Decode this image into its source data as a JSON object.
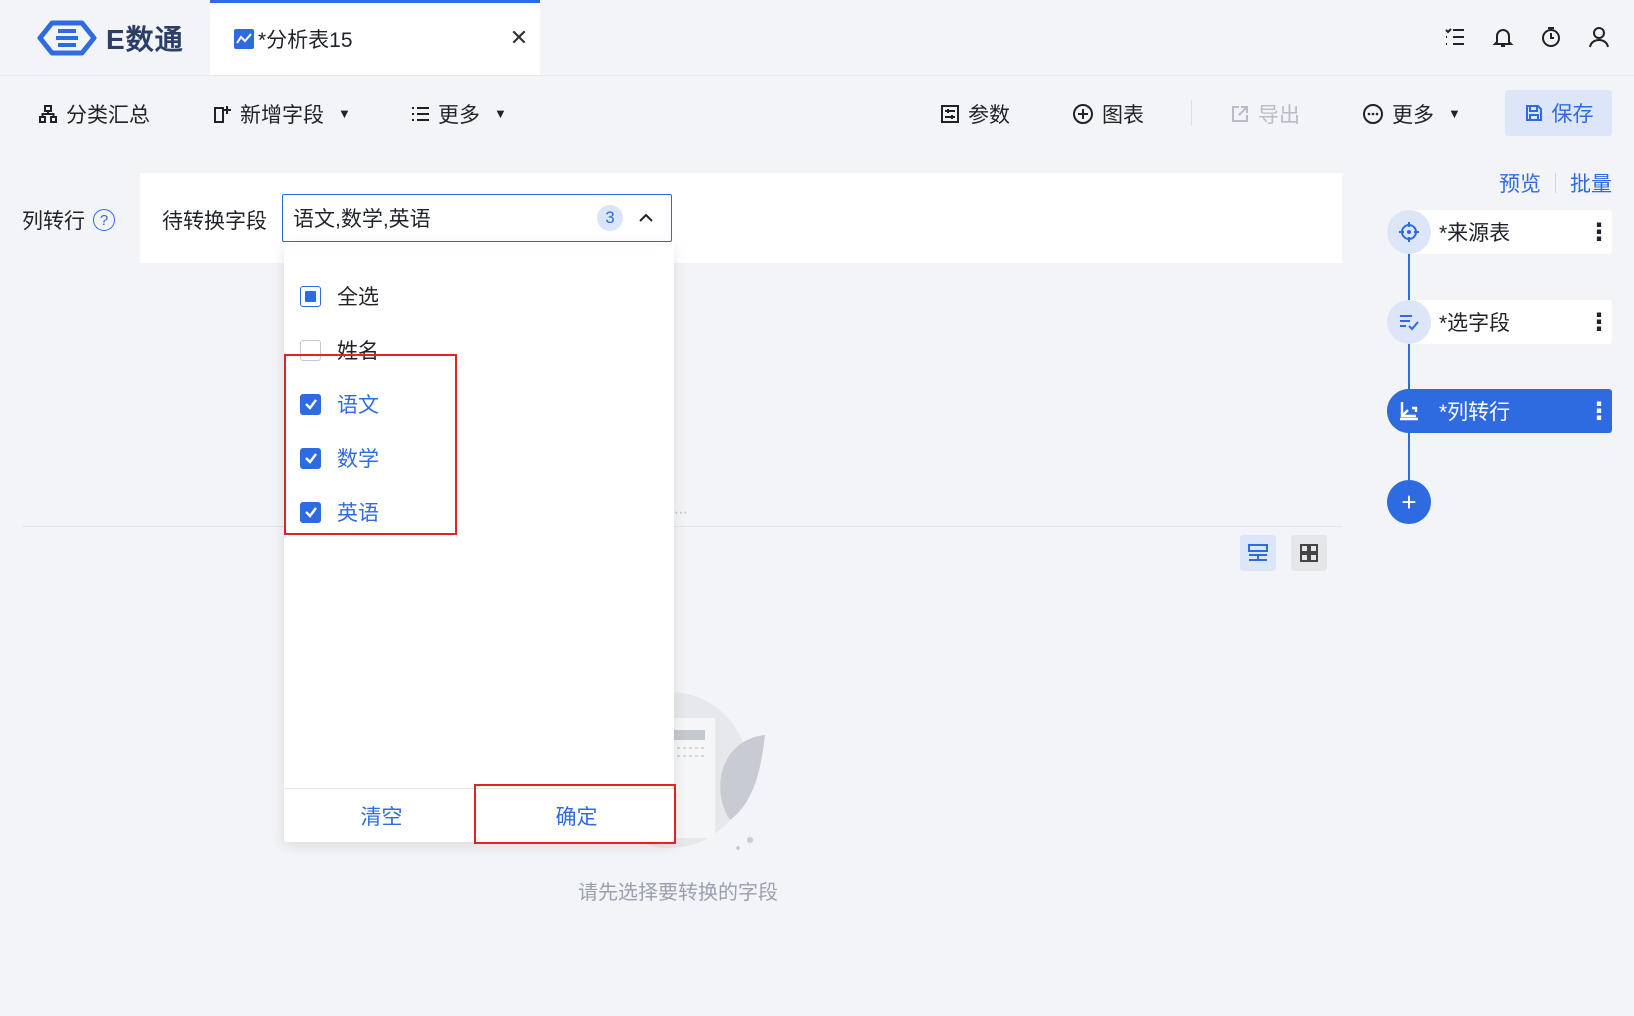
{
  "app": {
    "logo_text": "E数通"
  },
  "tab": {
    "title": "*分析表15",
    "close_glyph": "✕"
  },
  "top_icons": [
    "list-icon",
    "bell-icon",
    "timer-icon",
    "user-icon"
  ],
  "toolbar": {
    "group_summary": "分类汇总",
    "add_field": "新增字段",
    "more_left": "更多",
    "params": "参数",
    "chart": "图表",
    "export": "导出",
    "more_right": "更多",
    "save": "保存"
  },
  "section": {
    "label": "列转行",
    "help_glyph": "?"
  },
  "field_select": {
    "label": "待转换字段",
    "value": "语文,数学,英语",
    "count": "3"
  },
  "dropdown": {
    "options": [
      {
        "label": "全选",
        "state": "partial"
      },
      {
        "label": "姓名",
        "state": "unchecked"
      },
      {
        "label": "语文",
        "state": "checked"
      },
      {
        "label": "数学",
        "state": "checked"
      },
      {
        "label": "英语",
        "state": "checked"
      }
    ],
    "clear": "清空",
    "confirm": "确定"
  },
  "empty_state": {
    "message": "请先选择要转换的字段"
  },
  "flow_panel": {
    "preview": "预览",
    "batch": "批量",
    "nodes": [
      {
        "label": "*来源表",
        "icon": "target-icon",
        "active": false
      },
      {
        "label": "*选字段",
        "icon": "select-fields-icon",
        "active": false
      },
      {
        "label": "*列转行",
        "icon": "transpose-icon",
        "active": true
      }
    ],
    "more_glyph": "⋮",
    "add_glyph": "+"
  },
  "colors": {
    "accent": "#2f6be0",
    "highlight": "#e02424",
    "background": "#f3f4f7"
  }
}
